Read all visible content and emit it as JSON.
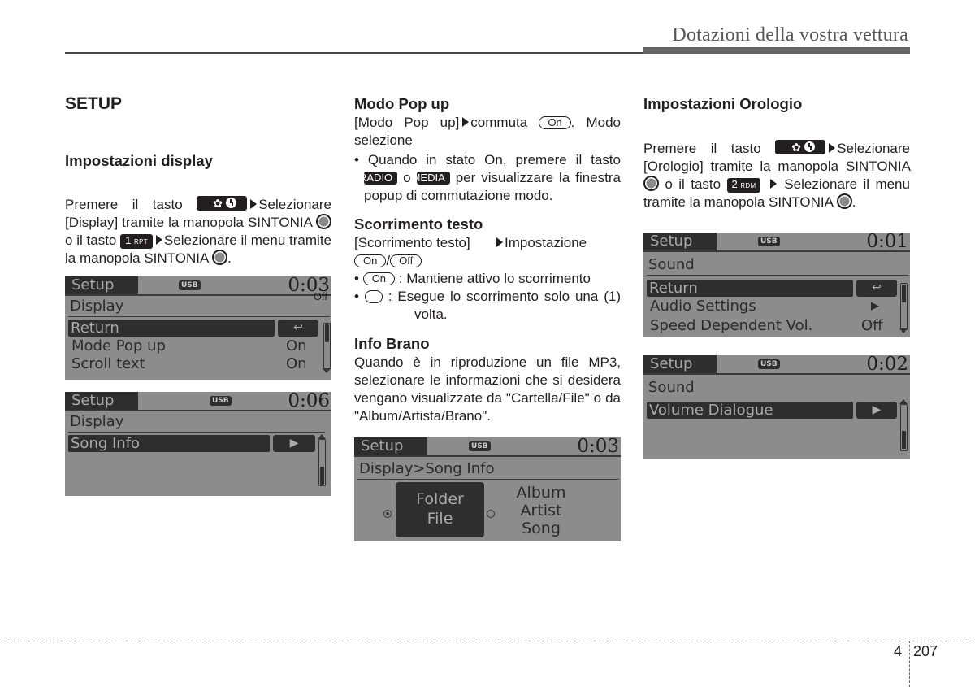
{
  "header": {
    "title": "Dotazioni della vostra vettura"
  },
  "column1": {
    "section_title": "SETUP",
    "subsection_title": "Impostazioni display",
    "para": {
      "t1": "Premere il tasto",
      "t2": "Selezionare [Display] tramite la manopola SINTONIA",
      "t3": "o il tasto",
      "t4": "Selezionare il menu tramite la manopola SINTONIA",
      "t5": "."
    },
    "key_rpt": {
      "num": "1",
      "label": "RPT"
    },
    "screen1": {
      "tag": "Setup",
      "usb": "USB",
      "time": "0:03",
      "crumb": "Display",
      "selected": "Return",
      "rows": [
        {
          "label": "Mode Pop up",
          "value": "On"
        },
        {
          "label": "Scroll text",
          "value": "On"
        }
      ]
    },
    "screen2": {
      "tag": "Setup",
      "usb": "USB",
      "time": "0:06",
      "crumb": "Display",
      "selected": "Song Info"
    }
  },
  "column2": {
    "popup": {
      "title": "Modo Pop up",
      "t1": "[Modo Pop up]",
      "t2": "commuta",
      "pill": "On",
      "t3": ". Modo selezione",
      "b1": "Quando in stato On, premere il tasto",
      "key_radio": "RADIO",
      "or": "o",
      "key_media": "MEDIA",
      "b2": "per visualizzare la finestra popup di commutazione modo."
    },
    "scroll": {
      "title": "Scorrimento testo",
      "t1": "[Scorrimento testo]",
      "t2": "Impostazione",
      "pill_on": "On",
      "slash": "/",
      "pill_off": "Off",
      "b1": ": Mantiene attivo lo scorrimento",
      "b2": ": Esegue lo scorrimento solo una (1) volta."
    },
    "info": {
      "title": "Info Brano",
      "text": "Quando è in riproduzione un file MP3, selezionare le informazioni che si desidera vengano visualizzate da \"Cartella/File\" o da \"Album/Artista/Brano\"."
    },
    "screen3": {
      "tag": "Setup",
      "usb": "USB",
      "time": "0:03",
      "crumb": "Display>Song Info",
      "option1": [
        "Folder",
        "File"
      ],
      "option2": [
        "Album",
        "Artist",
        "Song"
      ],
      "selected_option": 1
    }
  },
  "column3": {
    "title": "Impostazioni Orologio",
    "para": {
      "t1": "Premere il tasto",
      "t2": "Selezionare [Orologio] tramite la manopola SINTONIA",
      "t3": "o il tasto",
      "t4": "Selezionare il menu tramite la manopola SINTONIA",
      "t5": "."
    },
    "key_rdm": {
      "num": "2",
      "label": "RDM"
    },
    "screen4": {
      "tag": "Setup",
      "usb": "USB",
      "time": "0:01",
      "crumb": "Sound",
      "selected": "Return",
      "rows": [
        {
          "label": "Audio Settings",
          "value": "▶"
        },
        {
          "label": "Speed Dependent Vol.",
          "value": "Off"
        }
      ]
    },
    "screen5": {
      "tag": "Setup",
      "usb": "USB",
      "time": "0:02",
      "crumb": "Sound",
      "selected": "Volume Dialogue"
    }
  },
  "footer": {
    "chapter": "4",
    "page": "207"
  }
}
